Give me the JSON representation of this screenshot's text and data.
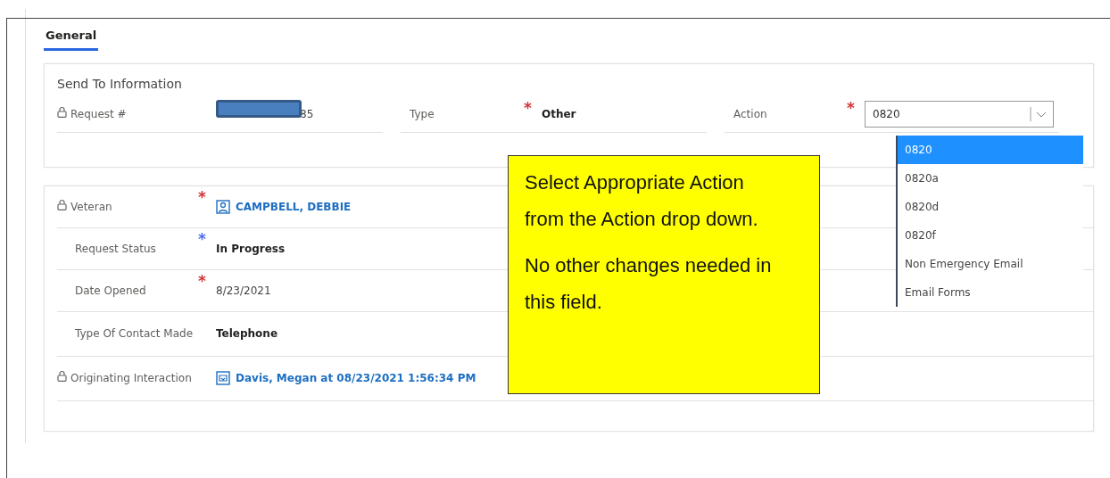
{
  "tabs": [
    {
      "label": "General",
      "selected": true
    }
  ],
  "send_to_information": {
    "title": "Send To Information",
    "fields": [
      {
        "kind": "plain",
        "label": "Request #",
        "locked": true,
        "value": "85",
        "redacted": true
      },
      {
        "kind": "bold",
        "label": "Type",
        "locked": false,
        "required_mark": {
          "text": "*",
          "color": "#d13438"
        },
        "value": "Other"
      },
      {
        "kind": "select",
        "label": "Action",
        "locked": false,
        "required_mark": {
          "text": "*",
          "color": "#d13438"
        },
        "value": "0820",
        "expanded": true
      }
    ]
  },
  "action_options": [
    {
      "label": "0820",
      "selected": true
    },
    {
      "label": "0820a",
      "selected": false
    },
    {
      "label": "0820d",
      "selected": false
    },
    {
      "label": "0820f",
      "selected": false
    },
    {
      "label": "Non Emergency Email",
      "selected": false
    },
    {
      "label": "Email Forms",
      "selected": false
    }
  ],
  "details": [
    {
      "kind": "contact_link",
      "label": "Veteran",
      "locked": true,
      "required_mark": {
        "text": "*",
        "color": "#d13438"
      },
      "value": "CAMPBELL, DEBBIE"
    },
    {
      "kind": "bold",
      "label": "Request Status",
      "locked": false,
      "required_mark": {
        "text": "*",
        "color": "#4f6bed"
      },
      "value": "In Progress"
    },
    {
      "kind": "plain",
      "label": "Date Opened",
      "locked": false,
      "required_mark": {
        "text": "*",
        "color": "#d13438"
      },
      "value": "8/23/2021"
    },
    {
      "kind": "bold",
      "label": "Type Of Contact Made",
      "locked": false,
      "value": "Telephone"
    },
    {
      "kind": "interaction_link",
      "label": "Originating Interaction",
      "locked": true,
      "value": "Davis, Megan at 08/23/2021 1:56:34 PM"
    }
  ],
  "callout": {
    "paragraphs": [
      "Select Appropriate Action from the Action drop down.",
      "No other changes needed in this field."
    ]
  }
}
